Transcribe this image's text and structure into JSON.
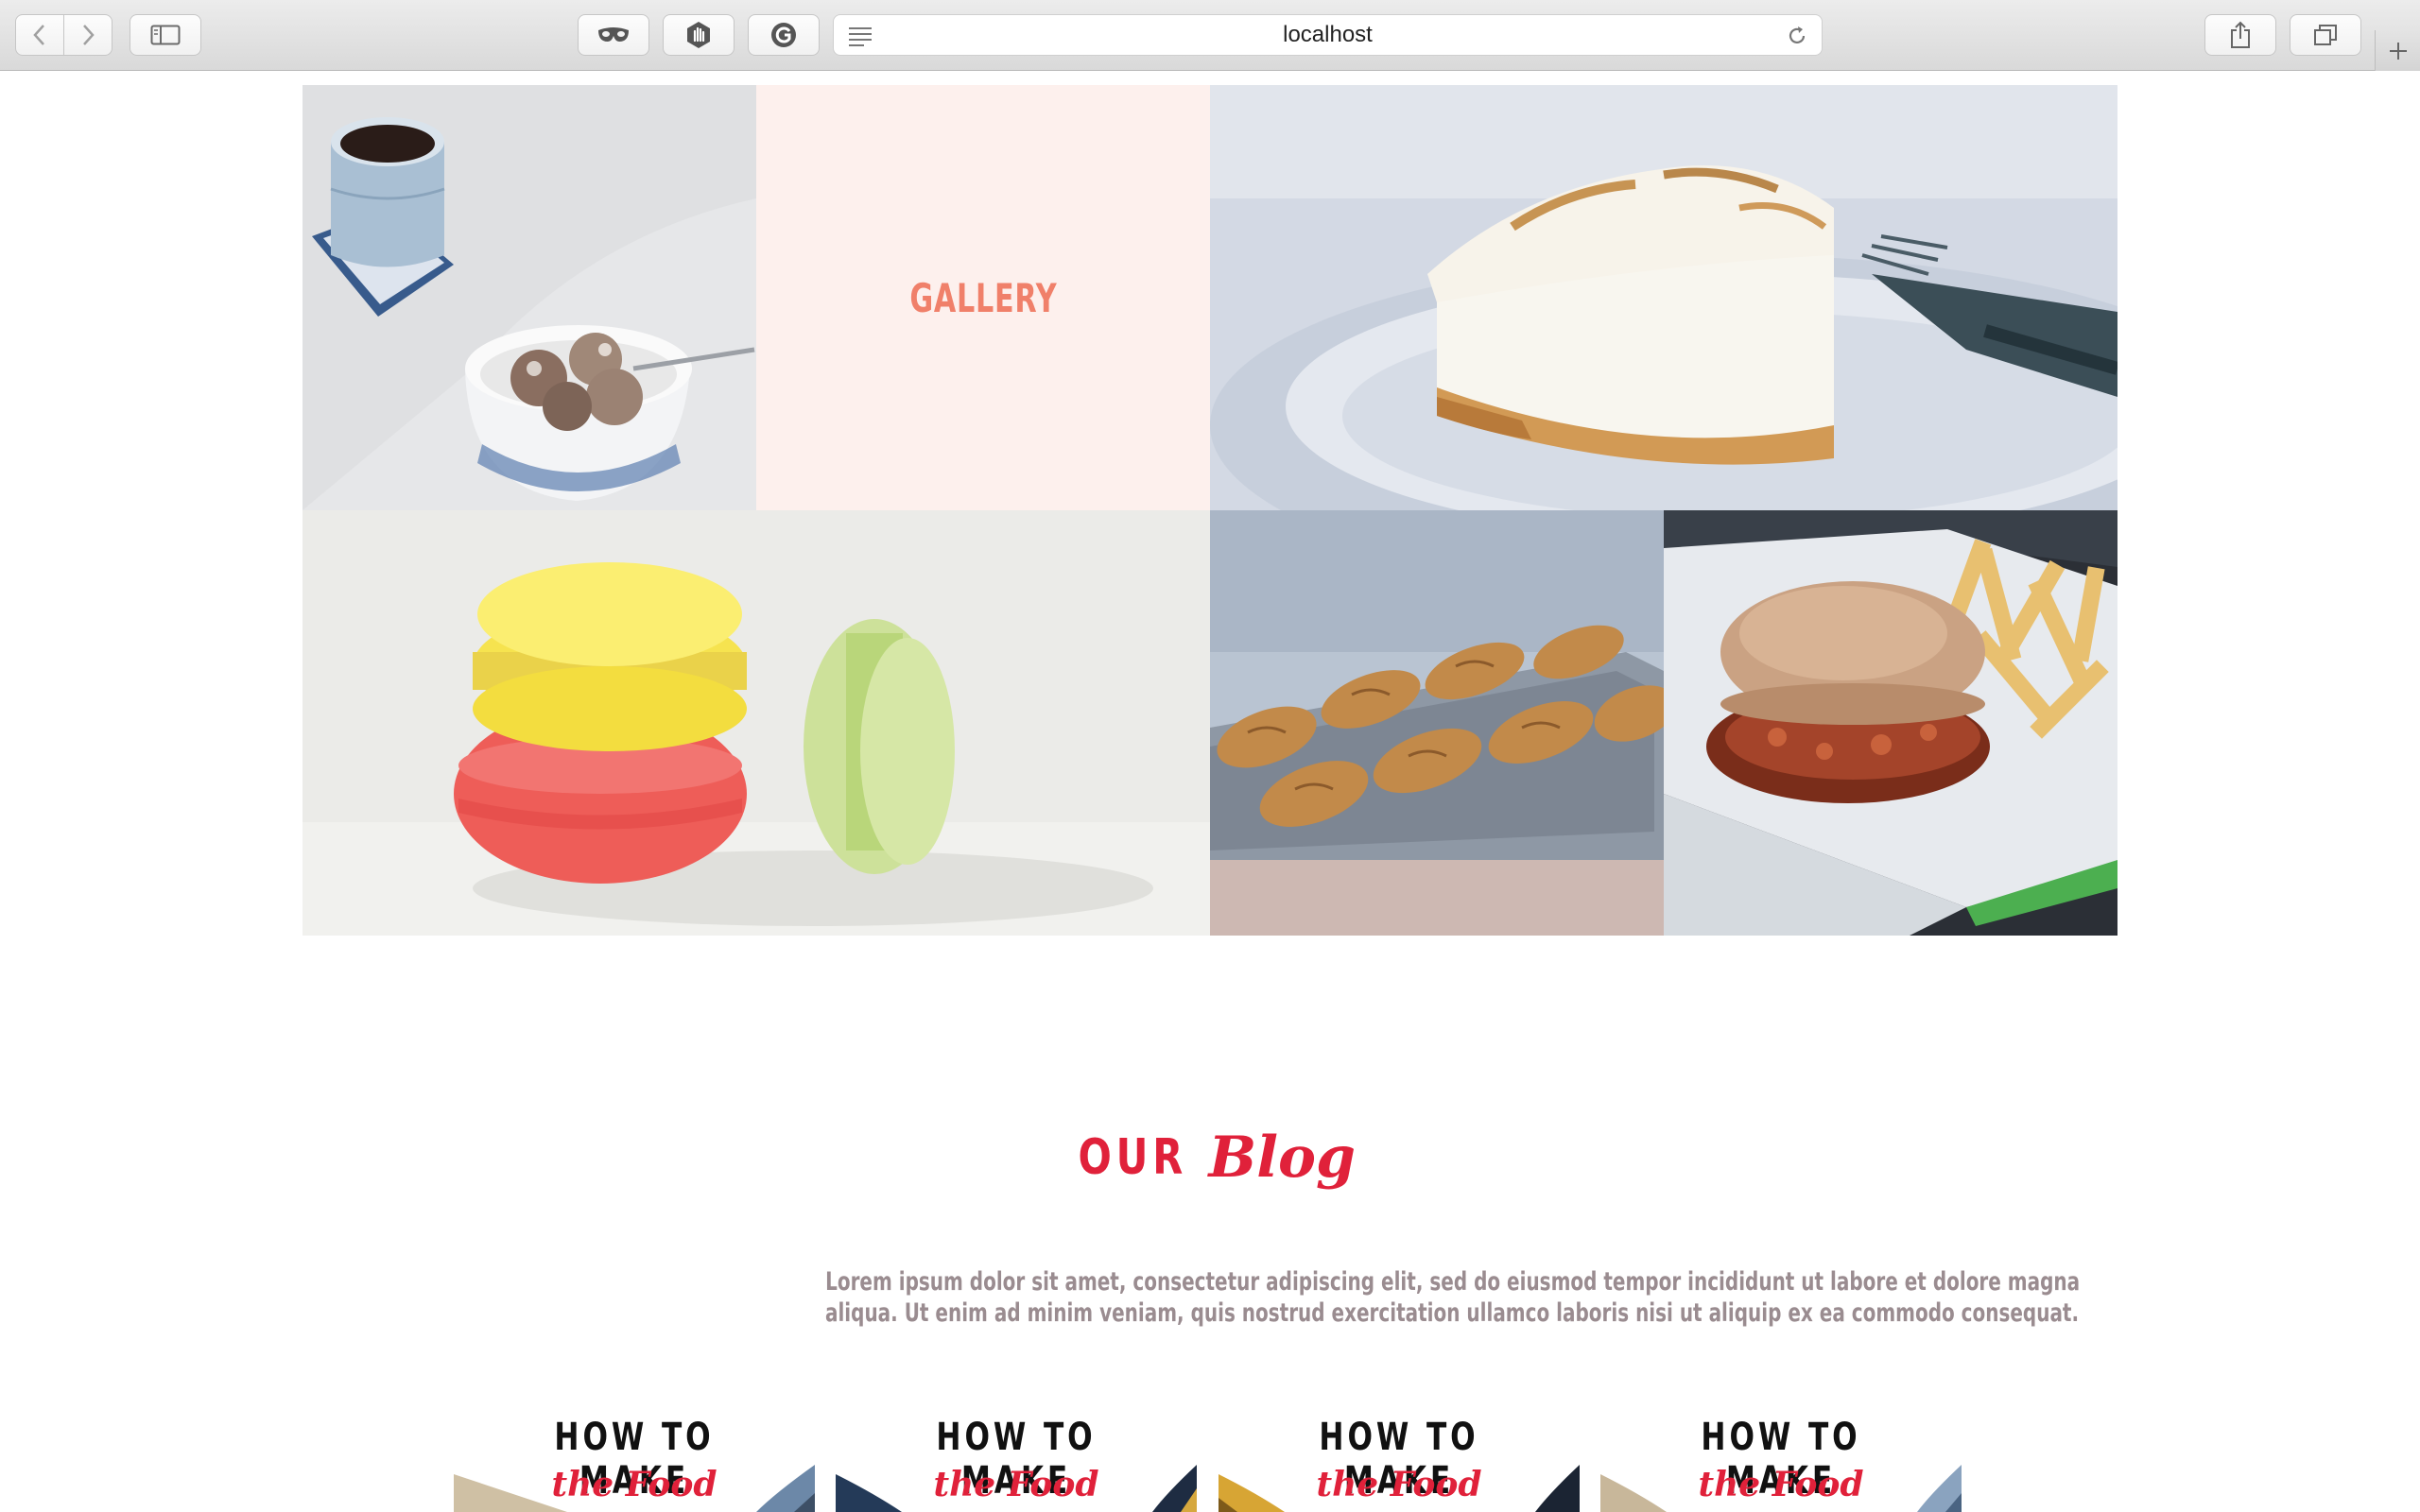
{
  "browser": {
    "url": "localhost",
    "icons": {
      "back": "chevron-left-icon",
      "forward": "chevron-right-icon",
      "sidebar": "sidebar-icon",
      "ext1": "mask-icon",
      "ext2": "hand-icon",
      "ext3": "grammarly-icon",
      "reader": "reader-icon",
      "reload": "reload-icon",
      "share": "share-icon",
      "tabs": "tabs-icon",
      "new_tab": "plus-icon"
    }
  },
  "gallery": {
    "title": "GALLERY",
    "title_color": "#f0806a",
    "title_bg": "#fdf0ed"
  },
  "blog": {
    "title_prefix": "OUR",
    "title_script": "Blog",
    "accent_color": "#e0213a",
    "description_line1": "Lorem ipsum dolor sit amet, consectetur adipiscing elit, sed do eiusmod tempor incididunt ut labore et dolore magna",
    "description_line2": "aliqua. Ut enim ad minim veniam, quis nostrud exercitation ullamco laboris nisi ut aliquip ex ea commodo consequat.",
    "cards": [
      {
        "line1": "HOW TO MAKE",
        "line2": "the Food"
      },
      {
        "line1": "HOW TO MAKE",
        "line2": "the Food"
      },
      {
        "line1": "HOW TO MAKE",
        "line2": "the Food"
      },
      {
        "line1": "HOW TO MAKE",
        "line2": "the Food"
      }
    ]
  }
}
